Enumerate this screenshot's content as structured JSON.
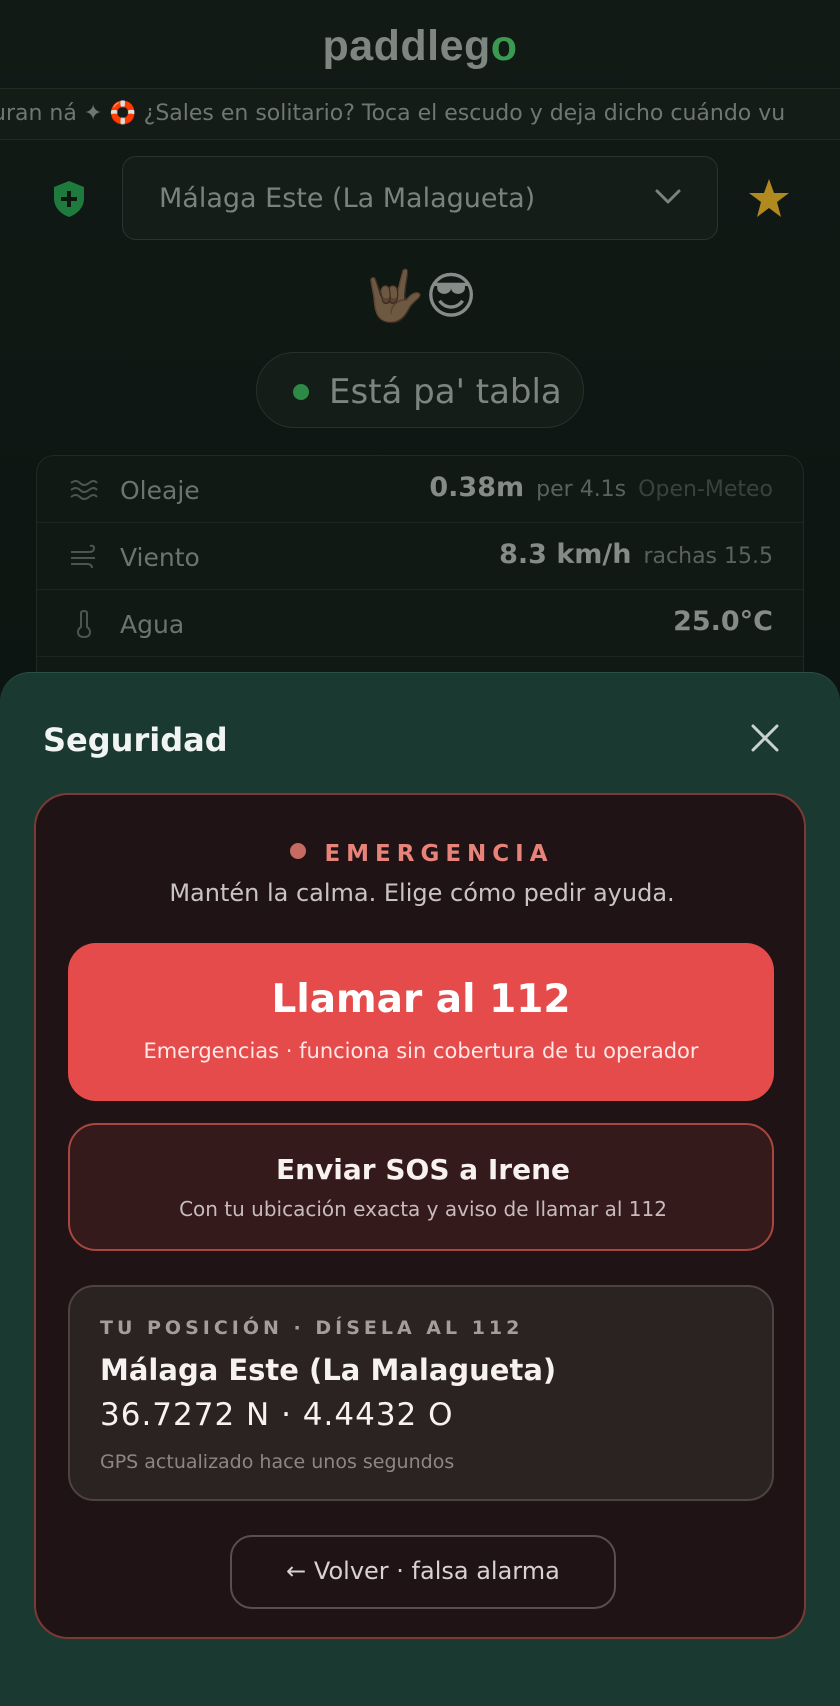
{
  "app": {
    "logo_main": "paddleg",
    "logo_accent": "o",
    "ticker": "uran ná ✦ 🛟 ¿Sales en solitario? Toca el escudo y deja dicho cuándo vu",
    "spot_selected": "Málaga Este (La Malagueta)",
    "emojis": "🤟🏽😎",
    "status": "Está pa' tabla",
    "metrics": [
      {
        "label": "Oleaje",
        "value": "0.38m",
        "detail": "per 4.1s",
        "source": "Open-Meteo"
      },
      {
        "label": "Viento",
        "value": "8.3 km/h",
        "detail": "rachas 15.5"
      },
      {
        "label": "Agua",
        "value": "25.0°C"
      }
    ]
  },
  "sheet": {
    "title": "Seguridad",
    "emergency": {
      "heading": "EMERGENCIA",
      "subtitle": "Mantén la calma. Elige cómo pedir ayuda.",
      "call": {
        "title": "Llamar al 112",
        "subtitle": "Emergencias · funciona sin cobertura de tu operador"
      },
      "sos": {
        "title": "Enviar SOS a Irene",
        "subtitle": "Con tu ubicación exacta y aviso de llamar al 112"
      },
      "position": {
        "label": "TU POSICIÓN · DÍSELA AL 112",
        "name": "Málaga Este (La Malagueta)",
        "coords": "36.7272 N · 4.4432 O",
        "gps": "GPS actualizado hace unos segundos"
      },
      "back": "← Volver · falsa alarma"
    }
  },
  "colors": {
    "accent_green": "#3a9a52",
    "sheet_bg": "#1a3a31",
    "emergency_red": "#e54b4b",
    "emergency_text": "#e8837a",
    "star_gold": "#d4a82a"
  }
}
